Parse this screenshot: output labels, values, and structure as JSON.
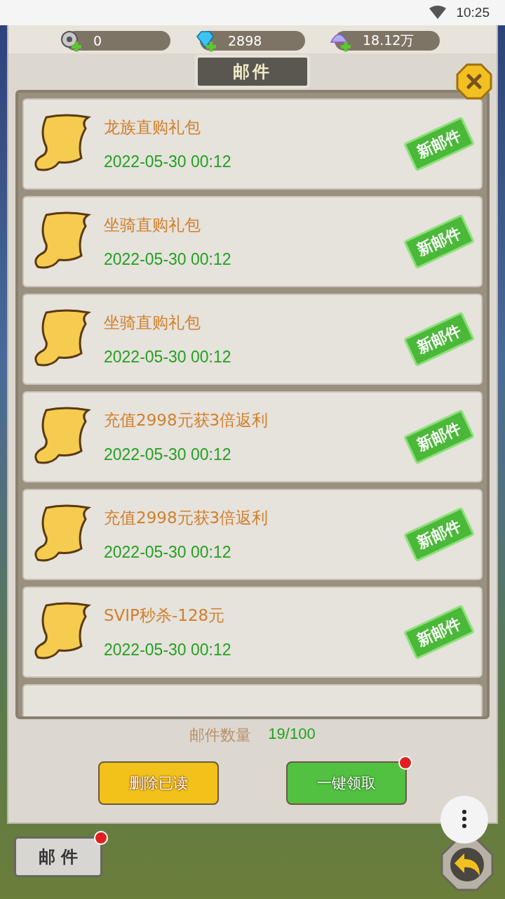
{
  "status_bar": {
    "time": "10:25"
  },
  "currencies": [
    {
      "kind": "gear",
      "amount": "0"
    },
    {
      "kind": "gem",
      "amount": "2898"
    },
    {
      "kind": "shell",
      "amount": "18.12万"
    }
  ],
  "window": {
    "title": "邮件"
  },
  "mails": [
    {
      "title": "龙族直购礼包",
      "date": "2022-05-30 00:12",
      "is_new": true,
      "stamp": "新邮件"
    },
    {
      "title": "坐骑直购礼包",
      "date": "2022-05-30 00:12",
      "is_new": true,
      "stamp": "新邮件"
    },
    {
      "title": "坐骑直购礼包",
      "date": "2022-05-30 00:12",
      "is_new": true,
      "stamp": "新邮件"
    },
    {
      "title": "充值2998元获3倍返利",
      "date": "2022-05-30 00:12",
      "is_new": true,
      "stamp": "新邮件"
    },
    {
      "title": "充值2998元获3倍返利",
      "date": "2022-05-30 00:12",
      "is_new": true,
      "stamp": "新邮件"
    },
    {
      "title": "SVIP秒杀-128元",
      "date": "2022-05-30 00:12",
      "is_new": true,
      "stamp": "新邮件"
    }
  ],
  "mail_count": {
    "label": "邮件数量",
    "value": "19/100"
  },
  "buttons": [
    {
      "kind": "delete",
      "label": "删除已读",
      "notify": false
    },
    {
      "kind": "claim",
      "label": "一键领取",
      "notify": true
    }
  ],
  "bottom_tab": {
    "label": "邮 件",
    "notify": true
  }
}
